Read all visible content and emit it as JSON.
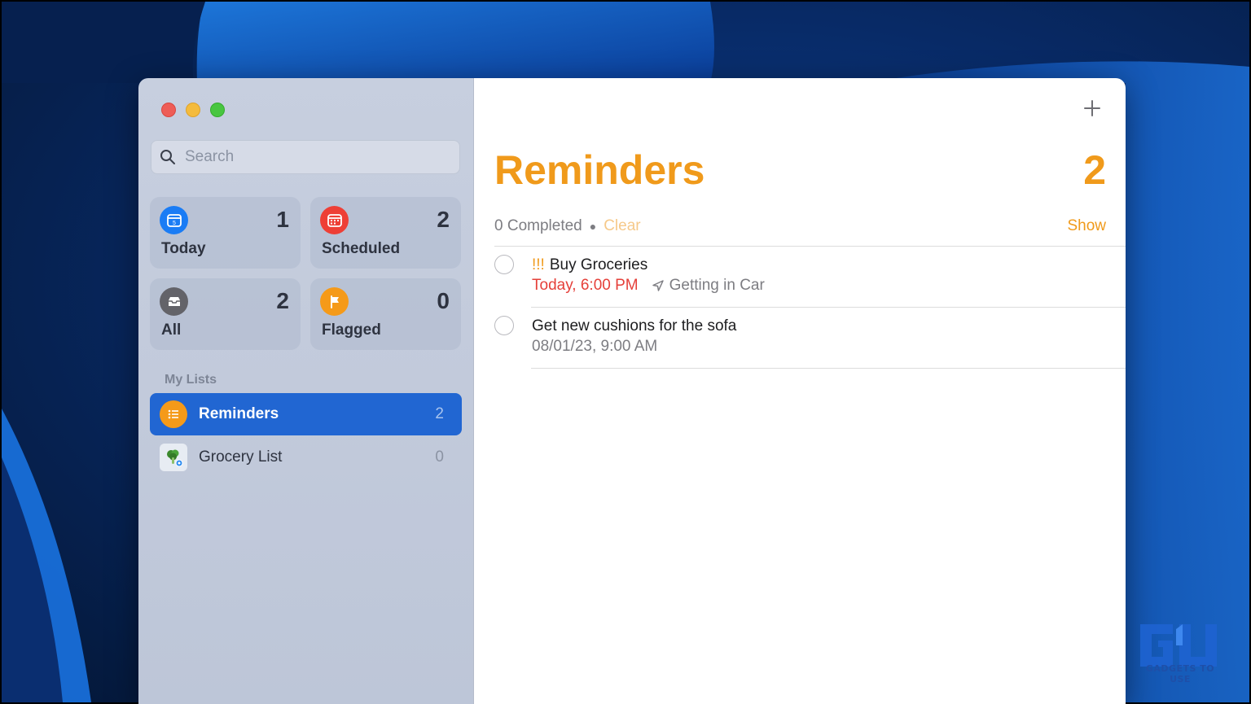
{
  "window": {
    "traffic_lights": [
      "close",
      "minimize",
      "zoom"
    ]
  },
  "sidebar": {
    "search": {
      "placeholder": "Search",
      "value": ""
    },
    "smart_lists": [
      {
        "id": "today",
        "label": "Today",
        "count": "1",
        "icon": "calendar-today-icon",
        "color": "#1a7cf5"
      },
      {
        "id": "scheduled",
        "label": "Scheduled",
        "count": "2",
        "icon": "calendar-scheduled-icon",
        "color": "#ee3f36"
      },
      {
        "id": "all",
        "label": "All",
        "count": "2",
        "icon": "tray-icon",
        "color": "#636369"
      },
      {
        "id": "flagged",
        "label": "Flagged",
        "count": "0",
        "icon": "flag-icon",
        "color": "#f59a19"
      }
    ],
    "section_label": "My Lists",
    "lists": [
      {
        "label": "Reminders",
        "count": "2",
        "icon": "list-bullet-icon",
        "color": "#f59a19",
        "selected": true
      },
      {
        "label": "Grocery List",
        "count": "0",
        "icon": "broccoli-icon",
        "selected": false
      }
    ]
  },
  "main": {
    "title": "Reminders",
    "count": "2",
    "completed_text": "0 Completed",
    "clear_label": "Clear",
    "show_label": "Show",
    "add_button_icon": "plus-icon",
    "reminders": [
      {
        "priority": "!!!",
        "title": "Buy Groceries",
        "due": "Today, 6:00 PM",
        "location": "Getting in Car",
        "location_icon": "location-arrow-icon"
      },
      {
        "priority": "",
        "title": "Get new cushions for the sofa",
        "due": "08/01/23, 9:00 AM"
      }
    ]
  },
  "watermark": {
    "text": "GADGETS TO USE"
  },
  "colors": {
    "accent": "#f09a1b",
    "selection": "#2166d2",
    "due_red": "#e5403a"
  }
}
